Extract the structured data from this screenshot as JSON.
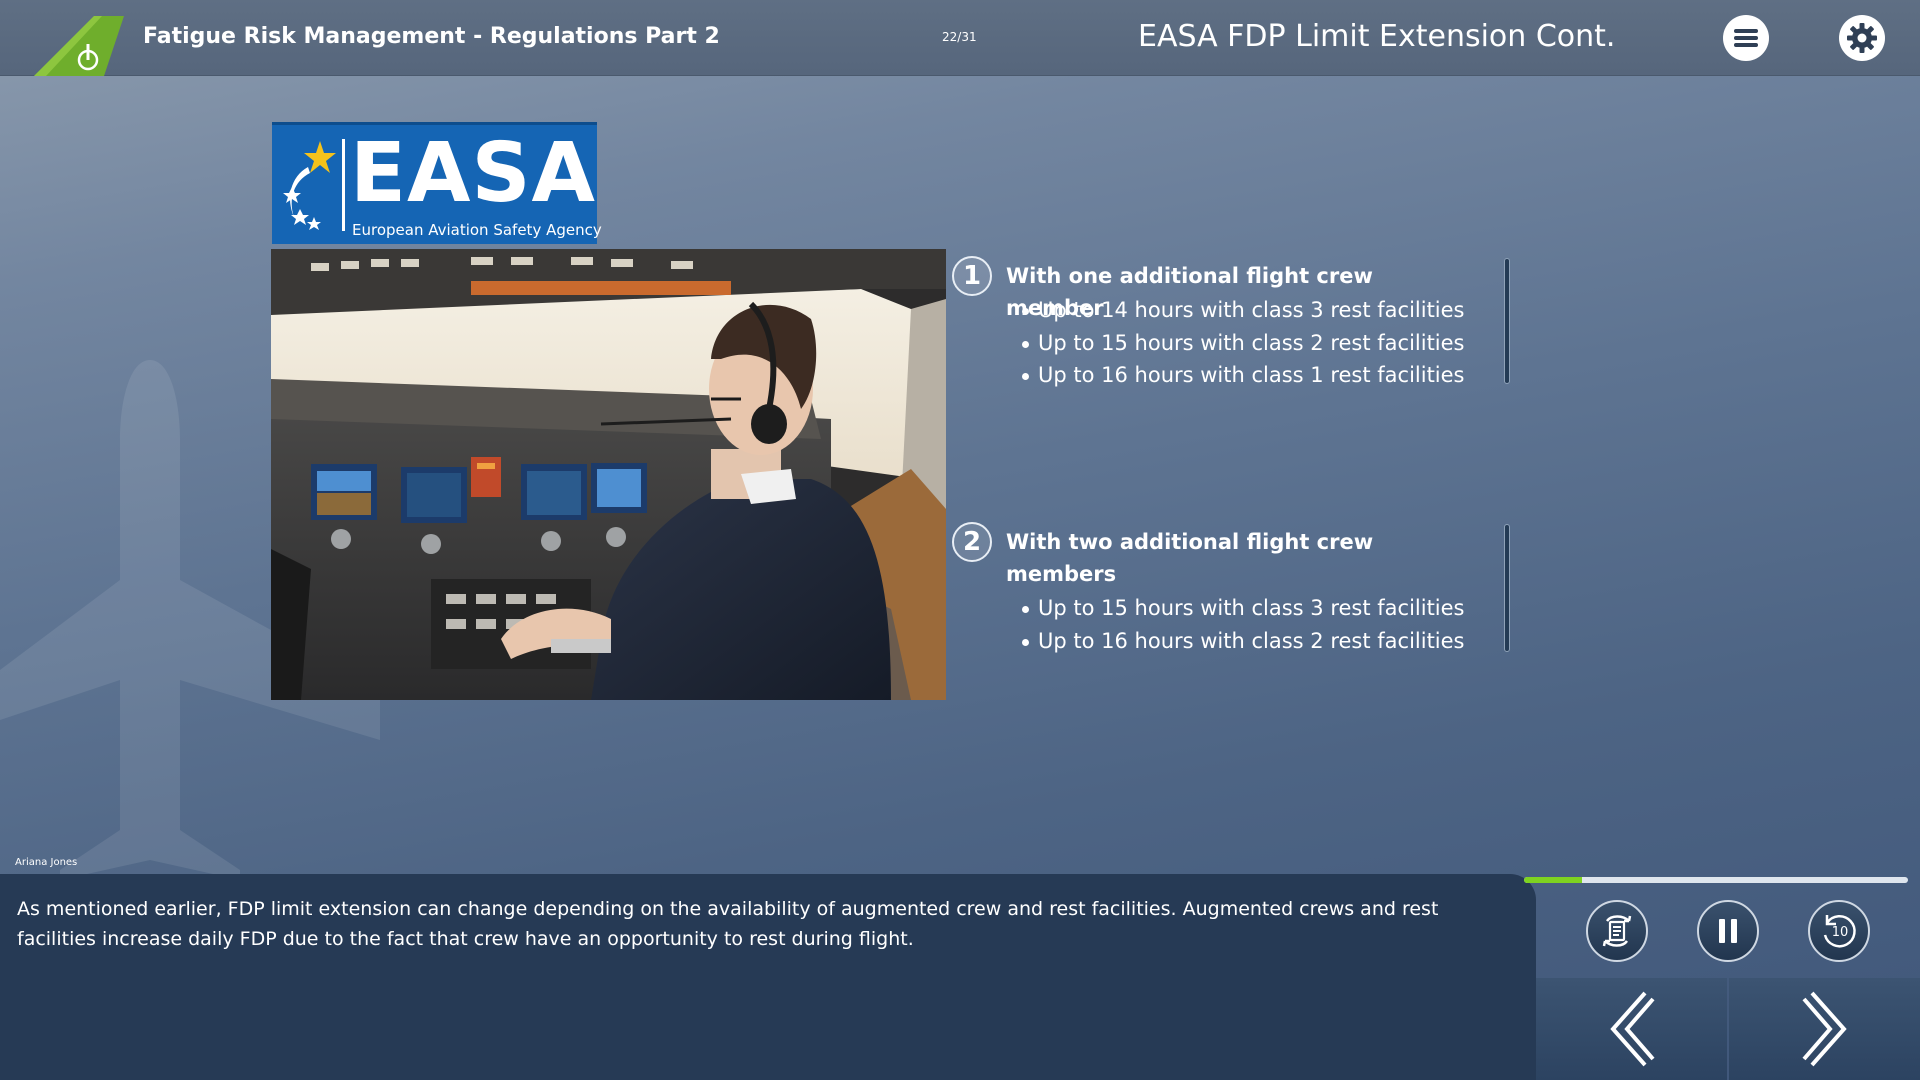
{
  "header": {
    "course_title": "Fatigue Risk Management - Regulations Part 2",
    "page_count": "22/31",
    "slide_title": "EASA FDP Limit Extension Cont."
  },
  "easa_logo": {
    "word": "EASA",
    "subtitle": "European Aviation Safety Agency"
  },
  "content": {
    "groups": [
      {
        "number": "1",
        "heading": "With one additional flight crew member",
        "items": [
          "Up to 14 hours with class 3 rest facilities",
          "Up to 15 hours with class 2 rest facilities",
          "Up to 16 hours with class 1 rest facilities"
        ]
      },
      {
        "number": "2",
        "heading": "With two additional flight crew members",
        "items": [
          "Up to 15 hours with class 3 rest facilities",
          "Up to 16 hours with class 2 rest facilities"
        ]
      }
    ]
  },
  "narrator": "Ariana Jones",
  "transcript": "As mentioned earlier, FDP limit extension can change depending on the availability of augmented crew and rest facilities. Augmented crews and rest facilities increase daily FDP due to the fact that crew have an opportunity to rest during flight.",
  "player": {
    "progress_fraction": 0.15,
    "rewind_seconds": "10"
  },
  "colors": {
    "accent_green": "#7ed321",
    "easa_blue": "#1565b4",
    "panel_dark": "#263a55"
  }
}
